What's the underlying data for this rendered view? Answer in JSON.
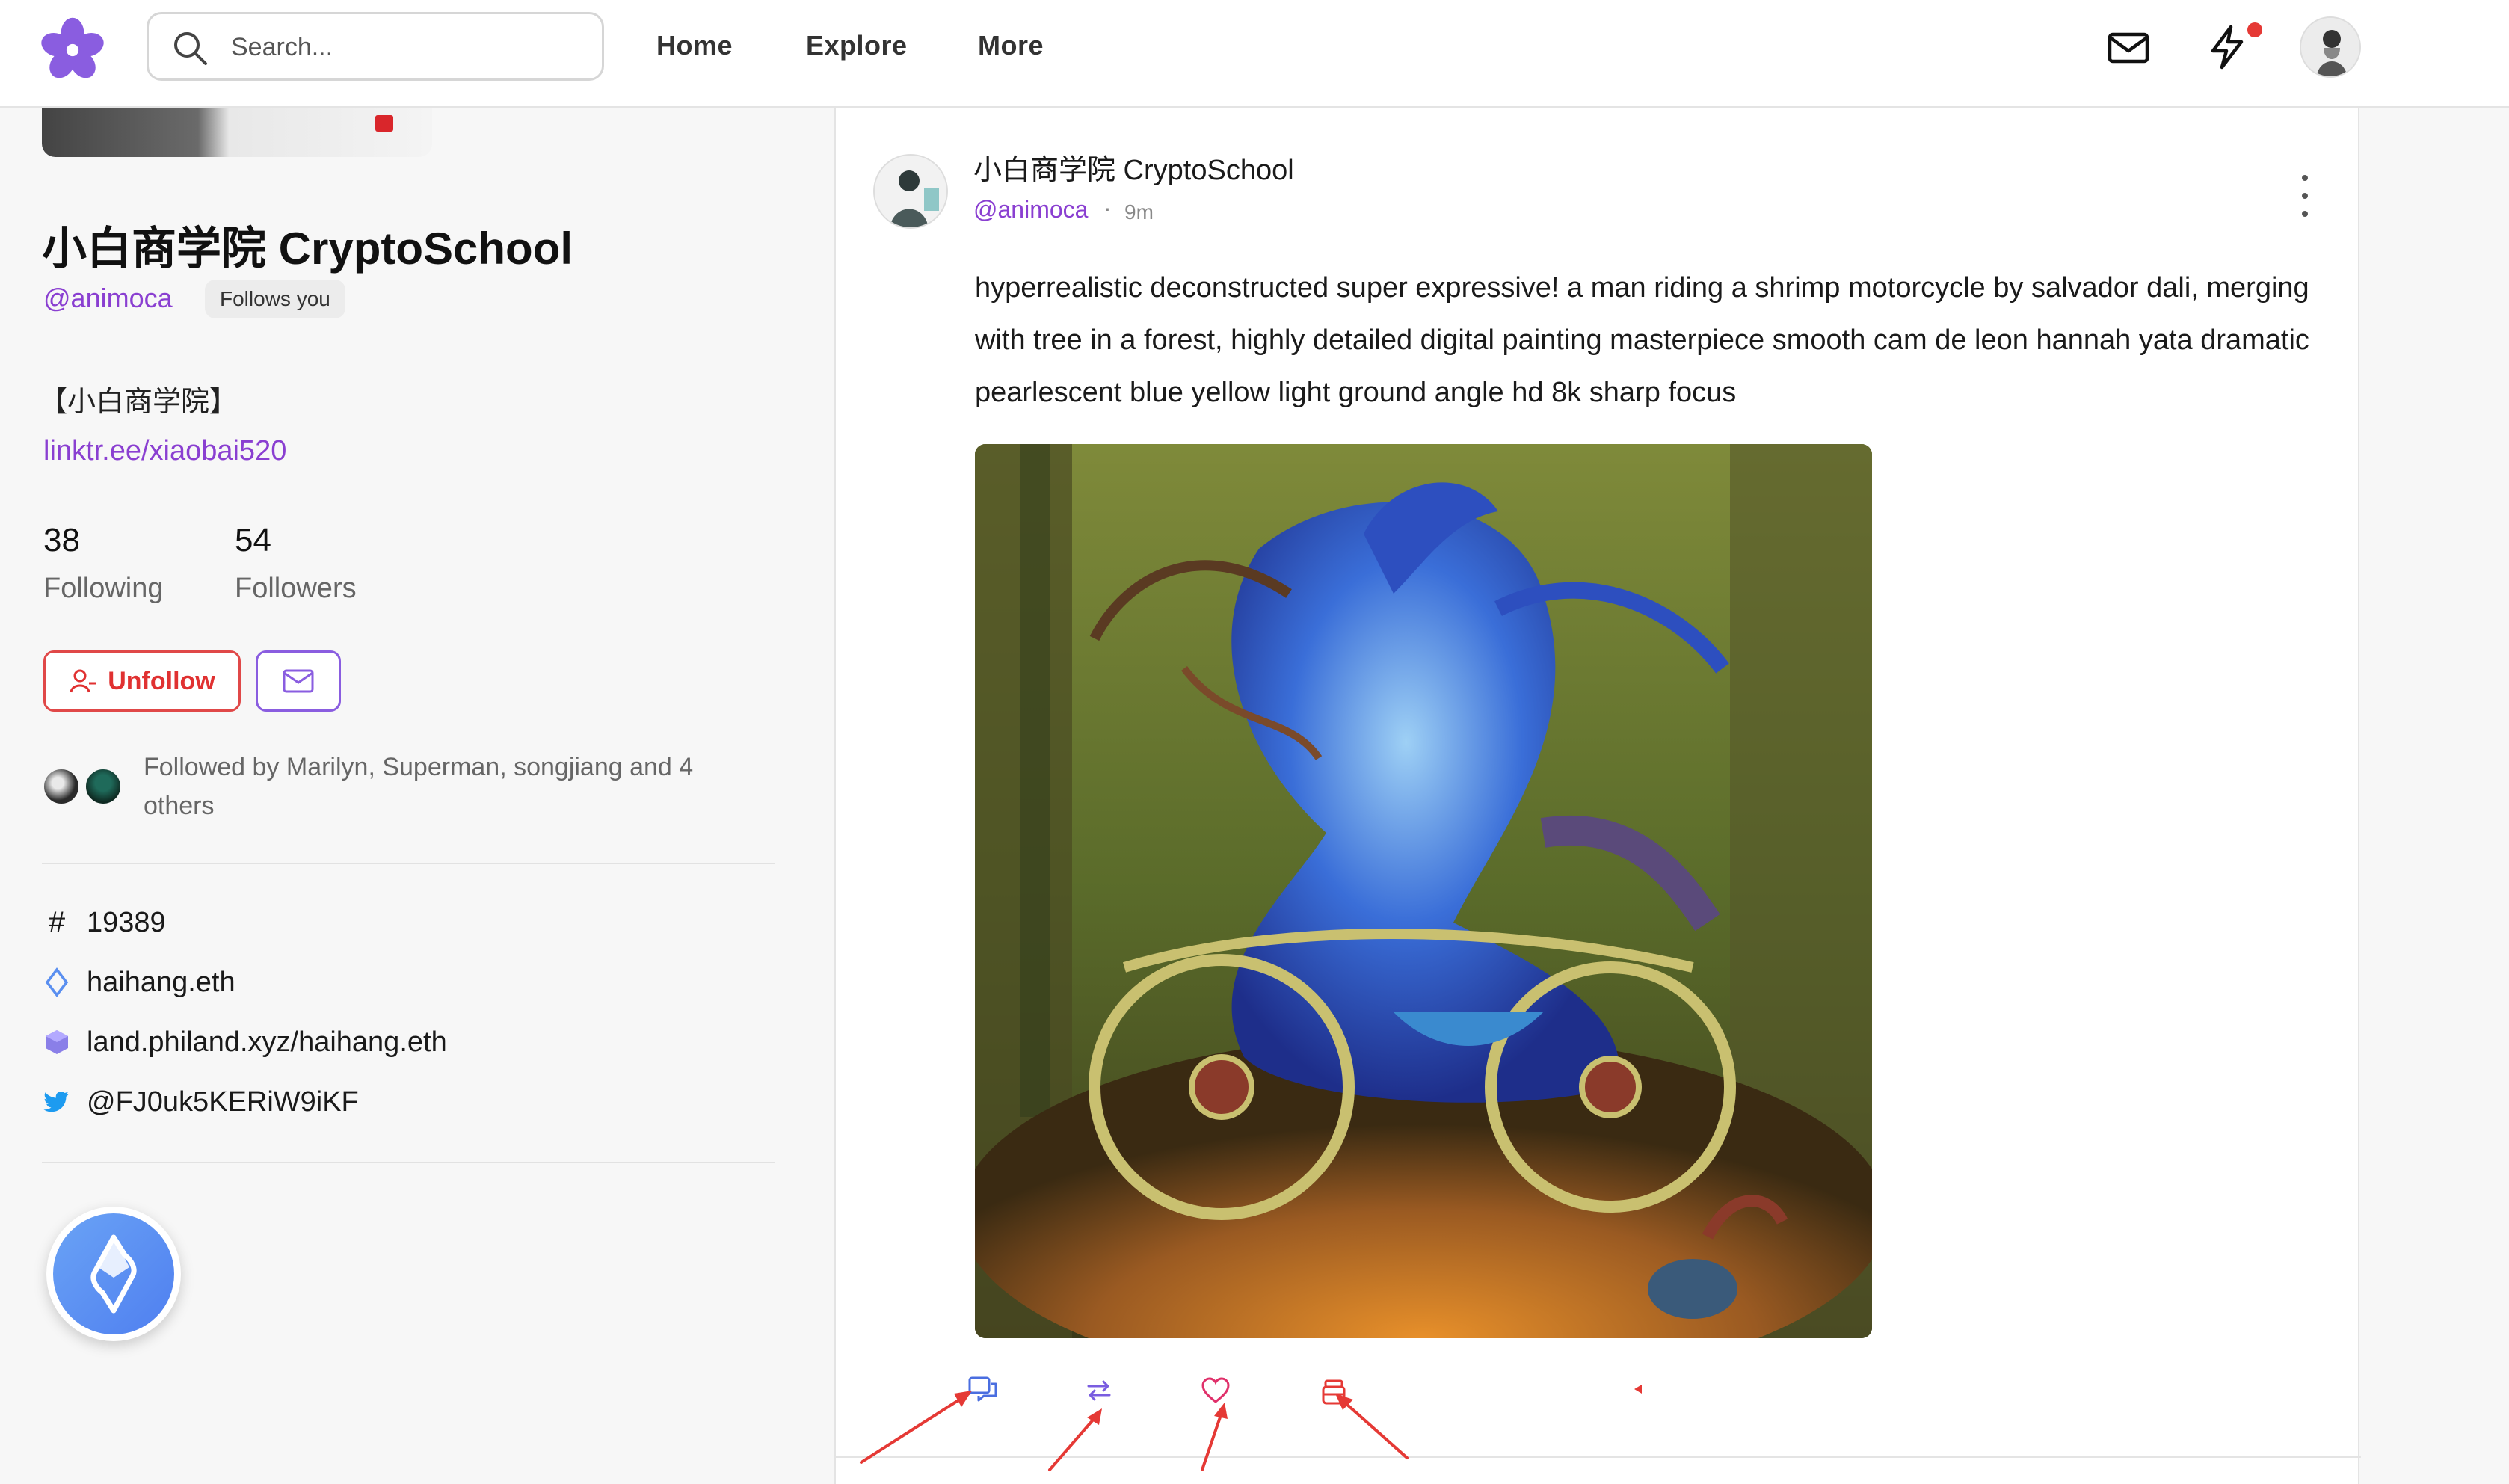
{
  "nav": {
    "search_placeholder": "Search...",
    "links": [
      "Home",
      "Explore",
      "More"
    ],
    "accent": "#8a5de0",
    "notification_dot": true
  },
  "profile": {
    "name": "小白商学院 CryptoSchool",
    "handle": "@animoca",
    "follows_you": "Follows you",
    "bio_title": "【小白商学院】",
    "bio_link": "linktr.ee/xiaobai520",
    "following_count": "38",
    "following_label": "Following",
    "followers_count": "54",
    "followers_label": "Followers",
    "unfollow_label": "Unfollow",
    "followed_by": "Followed by Marilyn, Superman, songjiang and 4 others",
    "meta": {
      "fid_symbol": "#",
      "fid": "19389",
      "ens": "haihang.eth",
      "phi": "land.philand.xyz/haihang.eth",
      "twitter": "@FJ0uk5KERiW9iKF"
    }
  },
  "post": {
    "author": "小白商学院 CryptoSchool",
    "handle": "@animoca",
    "separator": "·",
    "time": "9m",
    "text": "hyperrealistic deconstructed super expressive! a man riding a shrimp motorcycle by salvador dali, merging with tree in a forest, highly detailed digital painting masterpiece smooth cam de leon hannah yata dramatic pearlescent blue yellow light ground angle hd 8k sharp focus",
    "image_icon": "surreal-painting-image",
    "actions": [
      "comment-icon",
      "recast-icon",
      "like-icon",
      "tip-icon"
    ]
  },
  "colors": {
    "handle_purple": "#8a3fd1",
    "unfollow_red": "#e03131",
    "action_blue": "#4a6ee0",
    "action_red": "#e53935"
  }
}
